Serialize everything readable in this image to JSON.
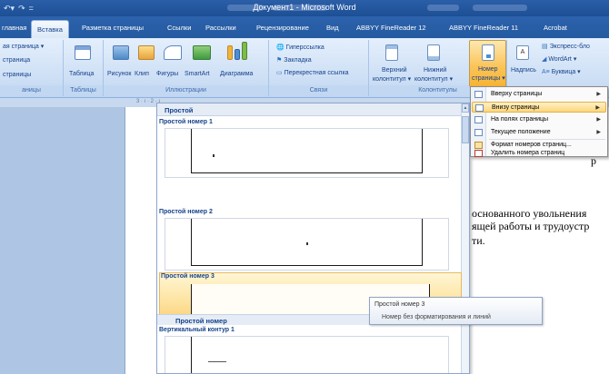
{
  "window": {
    "title": "Документ1 - Microsoft Word"
  },
  "tabs": [
    "главная",
    "Вставка",
    "Разметка страницы",
    "Ссылки",
    "Рассылки",
    "Рецензирование",
    "Вид",
    "ABBYY FineReader 12",
    "ABBYY FineReader 11",
    "Acrobat"
  ],
  "ribbon": {
    "pages_group": {
      "items": [
        "ая страница ▾",
        "страница",
        "страницы"
      ],
      "label": "аницы"
    },
    "tables_group": {
      "table_label": "Таблица",
      "label": "Таблицы"
    },
    "illustrations_group": {
      "items": [
        "Рисунок",
        "Клип",
        "Фигуры",
        "SmartArt",
        "Диаграмма"
      ],
      "label": "Иллюстрации"
    },
    "links_group": {
      "items": [
        "Гиперссылка",
        "Закладка",
        "Перекрестная ссылка"
      ],
      "label": "Связи"
    },
    "headers_group": {
      "header": [
        "Верхний",
        "колонтитул ▾"
      ],
      "footer": [
        "Нижний",
        "колонтитул ▾"
      ],
      "pagenum": [
        "Номер",
        "страницы ▾"
      ],
      "label": "Колонтитулы"
    },
    "text_group": {
      "textbox": "Надпись",
      "express": "Экспресс-бло",
      "wordart": "WordArt ▾",
      "dropcap": "Буквица ▾"
    }
  },
  "gallery": {
    "header": "Простой",
    "sections": [
      "Простой номер 1",
      "Простой номер 2",
      "Простой номер 3"
    ],
    "footer_label": "Простой номер",
    "next_section": "Вертикальный контур 1"
  },
  "context_menu": {
    "items": [
      {
        "label": "Вверху страницы",
        "has_submenu": true,
        "highlighted": false
      },
      {
        "label": "Внизу страницы",
        "has_submenu": true,
        "highlighted": true
      },
      {
        "label": "На полях страницы",
        "has_submenu": true,
        "highlighted": false
      },
      {
        "label": "Текущее положение",
        "has_submenu": true,
        "highlighted": false
      },
      {
        "label": "Формат номеров страниц...",
        "has_submenu": false,
        "highlighted": false
      },
      {
        "label": "Удалить номера страниц",
        "has_submenu": false,
        "highlighted": false
      }
    ]
  },
  "tooltip": {
    "title": "Простой номер 3",
    "description": "Номер без форматирования и линий"
  },
  "document": {
    "lines": [
      "р",
      "основанного увольнения",
      "ящей работы и трудоустр",
      "ти."
    ]
  },
  "ruler": {
    "marks": "3 · ı · 2 · ı"
  },
  "colors": {
    "accent_orange": "#fbc55a",
    "ribbon_blue": "#cddff5",
    "title_blue": "#1d4f94"
  }
}
